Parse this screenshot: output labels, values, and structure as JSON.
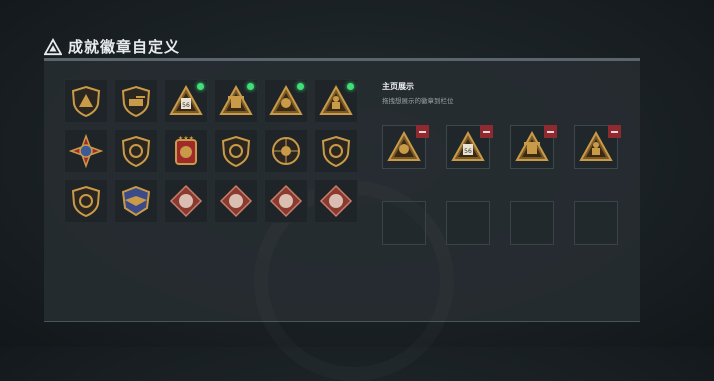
{
  "header": {
    "title": "成就徽章自定义",
    "icon": "triangle-a-icon"
  },
  "badges": [
    {
      "icon": "triangle-shield-badge-icon",
      "new": false
    },
    {
      "icon": "tank-shield-badge-icon",
      "new": false
    },
    {
      "icon": "triangle-56-badge-icon",
      "new": true
    },
    {
      "icon": "triangle-mech-badge-icon",
      "new": true
    },
    {
      "icon": "triangle-wing-badge-icon",
      "new": true
    },
    {
      "icon": "triangle-soldier-badge-icon",
      "new": true
    },
    {
      "icon": "cross-medal-badge-icon",
      "new": false
    },
    {
      "icon": "wing-shield-badge-icon",
      "new": false
    },
    {
      "icon": "star-crest-badge-icon",
      "new": false
    },
    {
      "icon": "wolf-shield-badge-icon",
      "new": false
    },
    {
      "icon": "skull-target-badge-icon",
      "new": false
    },
    {
      "icon": "claw-shield-badge-icon",
      "new": false
    },
    {
      "icon": "dino-shield-badge-icon",
      "new": false
    },
    {
      "icon": "eagle-crest-badge-icon",
      "new": false
    },
    {
      "icon": "beast-diamond-badge-icon",
      "new": false
    },
    {
      "icon": "dragon-diamond-badge-icon",
      "new": false
    },
    {
      "icon": "bear-diamond-badge-icon",
      "new": false
    },
    {
      "icon": "sword-diamond-badge-icon",
      "new": false
    }
  ],
  "showcase": {
    "title": "主页展示",
    "subtitle": "拖拽想展示的徽章到栏位",
    "slots": [
      {
        "icon": "triangle-wing-badge-icon",
        "filled": true
      },
      {
        "icon": "triangle-56-badge-icon",
        "filled": true
      },
      {
        "icon": "triangle-mech-badge-icon",
        "filled": true
      },
      {
        "icon": "triangle-soldier-badge-icon",
        "filled": true
      },
      {
        "filled": false
      },
      {
        "filled": false
      },
      {
        "filled": false
      },
      {
        "filled": false
      }
    ]
  },
  "colors": {
    "gold": "#c99a48",
    "dark_gold": "#7a5a28",
    "new_dot": "#3fe07a",
    "remove": "#8f2a31",
    "diamond": "#8a3a30"
  }
}
